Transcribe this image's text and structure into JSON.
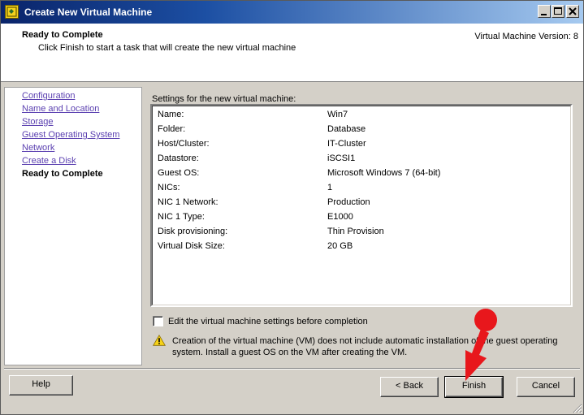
{
  "window": {
    "title": "Create New Virtual Machine",
    "icon": "vm-app-icon"
  },
  "header": {
    "title": "Ready to Complete",
    "subtitle": "Click Finish to start a task that will create the new virtual machine",
    "version": "Virtual Machine Version: 8"
  },
  "nav": {
    "items": [
      {
        "label": "Configuration"
      },
      {
        "label": "Name and Location"
      },
      {
        "label": "Storage"
      },
      {
        "label": "Guest Operating System"
      },
      {
        "label": "Network"
      },
      {
        "label": "Create a Disk"
      },
      {
        "label": "Ready to Complete",
        "current": true
      }
    ]
  },
  "settings": {
    "label": "Settings for the new virtual machine:",
    "rows": [
      {
        "key": "Name:",
        "value": "Win7"
      },
      {
        "key": "Folder:",
        "value": "Database"
      },
      {
        "key": "Host/Cluster:",
        "value": "IT-Cluster"
      },
      {
        "key": "Datastore:",
        "value": "iSCSI1"
      },
      {
        "key": "Guest OS:",
        "value": "Microsoft Windows 7 (64-bit)"
      },
      {
        "key": "NICs:",
        "value": "1"
      },
      {
        "key": "NIC 1 Network:",
        "value": "Production"
      },
      {
        "key": "NIC 1 Type:",
        "value": "E1000"
      },
      {
        "key": "Disk provisioning:",
        "value": "Thin Provision"
      },
      {
        "key": "Virtual Disk Size:",
        "value": "20 GB"
      }
    ]
  },
  "edit_checkbox": {
    "label": "Edit the virtual machine settings before completion",
    "checked": false
  },
  "warning": {
    "icon": "warning-icon",
    "text": "Creation of the virtual machine (VM) does not include automatic installation of the guest operating system. Install a guest OS on the VM after creating the VM."
  },
  "buttons": {
    "help": "Help",
    "back": "< Back",
    "finish": "Finish",
    "cancel": "Cancel"
  },
  "colors": {
    "titlebar_start": "#0a246a",
    "link": "#5a3fb0",
    "pointer": "#e8171c"
  }
}
